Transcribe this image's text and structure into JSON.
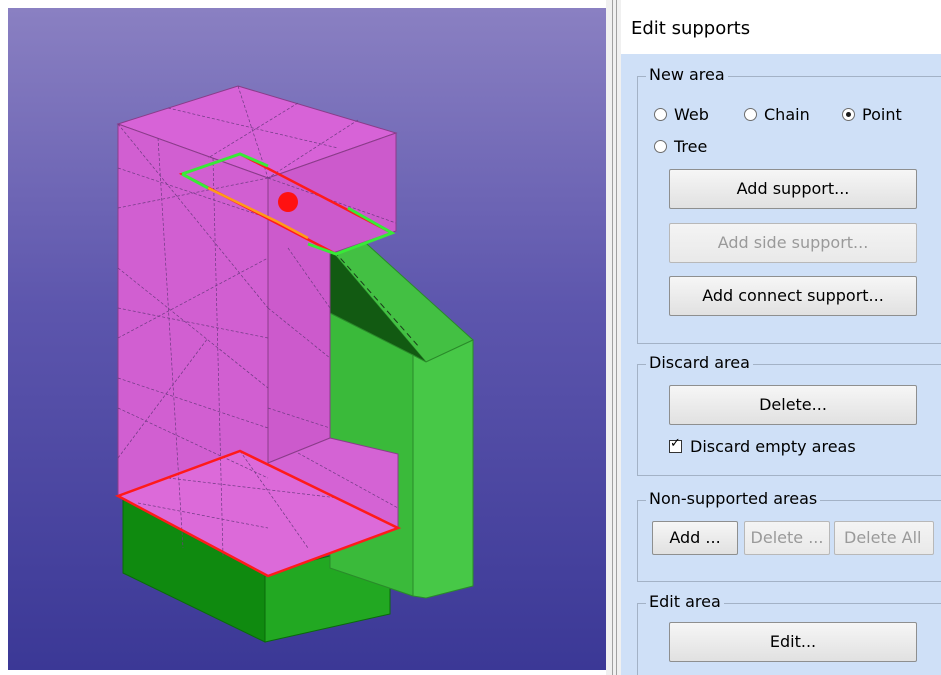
{
  "panel": {
    "title": "Edit supports",
    "new_area": {
      "legend": "New area",
      "options": [
        {
          "label": "Web",
          "checked": false
        },
        {
          "label": "Chain",
          "checked": false
        },
        {
          "label": "Point",
          "checked": true
        },
        {
          "label": "Tree",
          "checked": false
        }
      ],
      "add_support_label": "Add support...",
      "add_side_support_label": "Add side support...",
      "add_connect_support_label": "Add connect support..."
    },
    "discard_area": {
      "legend": "Discard area",
      "delete_label": "Delete...",
      "discard_empty_label": "Discard empty areas",
      "discard_empty_checked": true,
      "checkmark": "✓"
    },
    "non_supported": {
      "legend": "Non-supported areas",
      "add_label": "Add ...",
      "delete_label": "Delete ...",
      "delete_all_label": "Delete All"
    },
    "edit_area": {
      "legend": "Edit area",
      "edit_label": "Edit..."
    }
  },
  "viewport": {
    "model_color": "#d25fd2",
    "support_color": "#3cb83c",
    "highlight_color": "#ff1a1a",
    "selection_color": "#2ee82e"
  }
}
